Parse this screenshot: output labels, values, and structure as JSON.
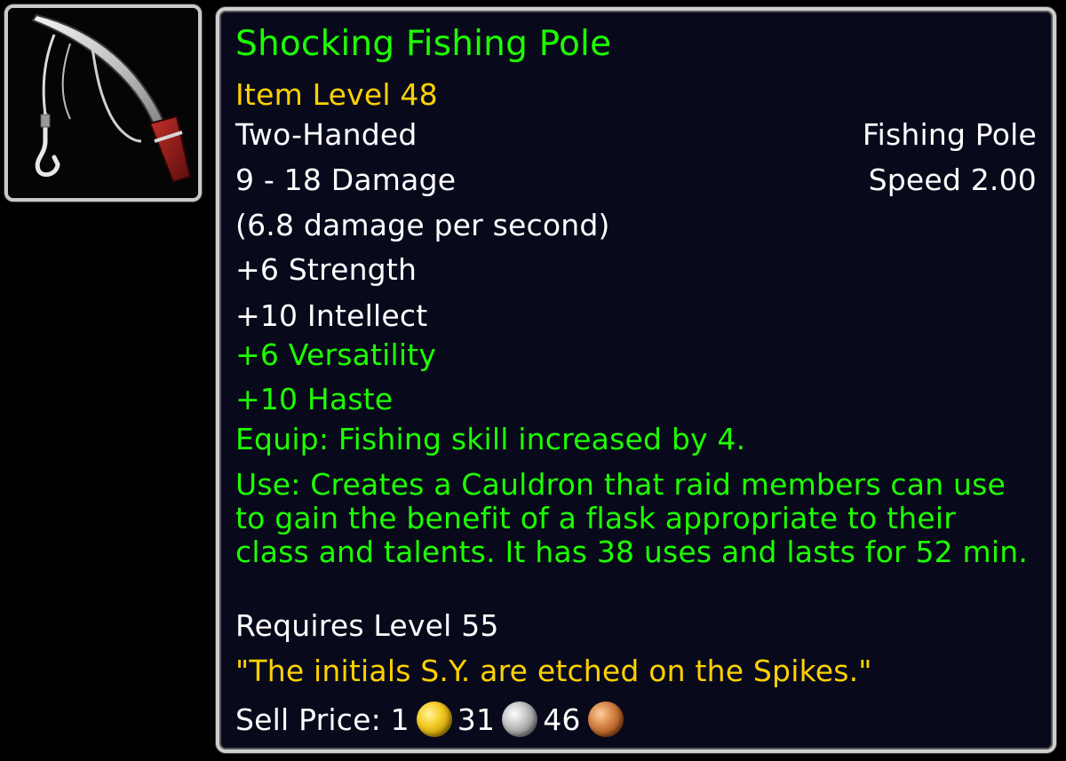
{
  "icon": {
    "name": "fishing-pole-icon"
  },
  "tooltip": {
    "title": "Shocking Fishing Pole",
    "item_level": "Item Level 48",
    "slot_left": "Two-Handed",
    "slot_right": "Fishing Pole",
    "damage": "9 - 18 Damage",
    "speed": "Speed 2.00",
    "dps": "(6.8 damage per second)",
    "stats": [
      "+6 Strength",
      "+10 Intellect"
    ],
    "green_stats": [
      "+6 Versatility",
      "+10 Haste"
    ],
    "equip": "Equip: Fishing skill increased by 4.",
    "use": "Use: Creates a Cauldron that raid members can use to gain the benefit of a flask appropriate to their class and talents. It has 38 uses and lasts for 52 min.",
    "requires": "Requires Level 55",
    "flavor": "\"The initials S.Y. are etched on the Spikes.\"",
    "sell_label": "Sell Price: ",
    "gold": "1",
    "silver": "31",
    "copper": "46"
  },
  "colors": {
    "title_green": "#1eff00",
    "item_level_gold": "#ffd100",
    "text_white": "#ffffff",
    "tooltip_bg": "#080a1c",
    "border": "#cfcfcf"
  }
}
